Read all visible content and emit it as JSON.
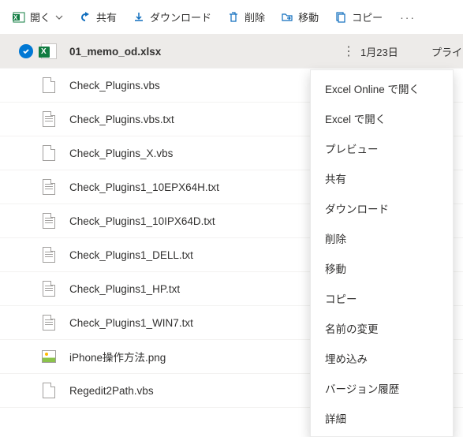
{
  "toolbar": {
    "open": "開く",
    "share": "共有",
    "download": "ダウンロード",
    "delete": "削除",
    "move": "移動",
    "copy": "コピー"
  },
  "selected": {
    "name": "01_memo_od.xlsx",
    "date": "1月23日",
    "priv": "プライ"
  },
  "priv_cut": "ライ",
  "files": [
    {
      "name": "Check_Plugins.vbs",
      "type": "generic"
    },
    {
      "name": "Check_Plugins.vbs.txt",
      "type": "text"
    },
    {
      "name": "Check_Plugins_X.vbs",
      "type": "generic"
    },
    {
      "name": "Check_Plugins1_10EPX64H.txt",
      "type": "text"
    },
    {
      "name": "Check_Plugins1_10IPX64D.txt",
      "type": "text"
    },
    {
      "name": "Check_Plugins1_DELL.txt",
      "type": "text"
    },
    {
      "name": "Check_Plugins1_HP.txt",
      "type": "text"
    },
    {
      "name": "Check_Plugins1_WIN7.txt",
      "type": "text"
    },
    {
      "name": "iPhone操作方法.png",
      "type": "image"
    },
    {
      "name": "Regedit2Path.vbs",
      "type": "generic"
    }
  ],
  "ctx": {
    "open_online": "Excel Online で開く",
    "open_excel": "Excel で開く",
    "preview": "プレビュー",
    "share": "共有",
    "download": "ダウンロード",
    "delete": "削除",
    "move": "移動",
    "copy": "コピー",
    "rename": "名前の変更",
    "embed": "埋め込み",
    "version": "バージョン履歴",
    "details": "詳細"
  }
}
